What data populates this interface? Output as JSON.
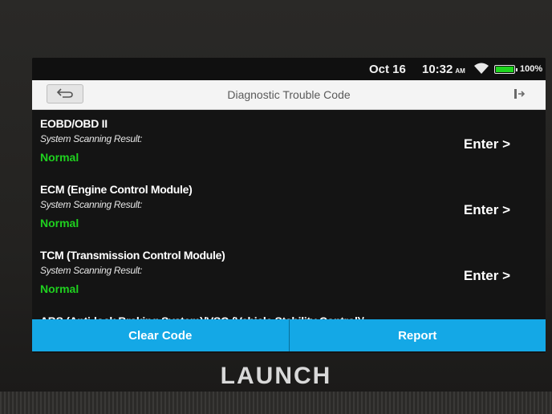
{
  "status_bar": {
    "date": "Oct 16",
    "time": "10:32",
    "ampm": "AM",
    "battery_percent": "100%",
    "battery_level": 1.0,
    "wifi_icon": "wifi-icon",
    "battery_color": "#1ed51e"
  },
  "header": {
    "title": "Diagnostic Trouble Code",
    "back_icon": "back-arrow-icon",
    "exit_icon": "exit-icon"
  },
  "systems": [
    {
      "name": "EOBD/OBD II",
      "scan_label": "System Scanning Result:",
      "result": "Normal",
      "action": "Enter >"
    },
    {
      "name": "ECM (Engine Control Module)",
      "scan_label": "System Scanning Result:",
      "result": "Normal",
      "action": "Enter >"
    },
    {
      "name": "TCM (Transmission Control Module)",
      "scan_label": "System Scanning Result:",
      "result": "Normal",
      "action": "Enter >"
    },
    {
      "name": "ABS (Anti-lock Braking System)/VSC (Vehicle Stability Control)/"
    }
  ],
  "actions": {
    "clear_code": "Clear Code",
    "report": "Report"
  },
  "device": {
    "brand": "LAUNCH"
  },
  "colors": {
    "accent": "#14a8e6",
    "normal": "#1fd11f"
  }
}
